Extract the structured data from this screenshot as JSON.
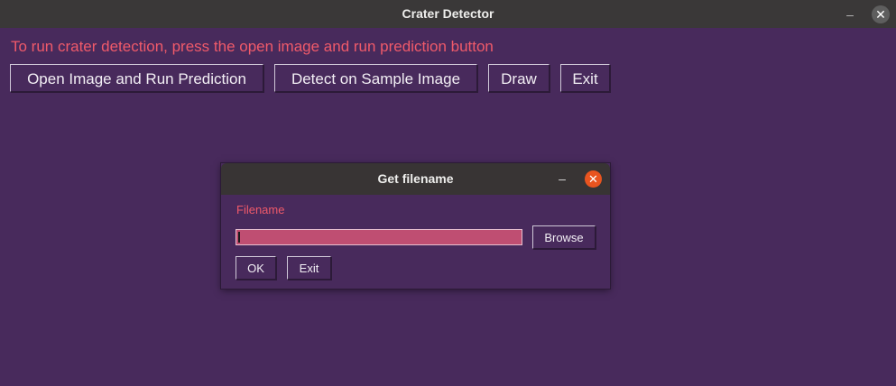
{
  "window": {
    "title": "Crater Detector",
    "minimize_glyph": "–",
    "close_glyph": "✕"
  },
  "main": {
    "instruction": "To run crater detection, press the open image and run prediction button",
    "buttons": {
      "open_predict": "Open Image and Run Prediction",
      "detect_sample": "Detect on Sample Image",
      "draw": "Draw",
      "exit": "Exit"
    }
  },
  "dialog": {
    "title": "Get filename",
    "minimize_glyph": "–",
    "close_glyph": "✕",
    "label": "Filename",
    "input_value": "",
    "browse": "Browse",
    "ok": "OK",
    "exit": "Exit"
  },
  "colors": {
    "background": "#482a5c",
    "titlebar": "#3a3838",
    "accent_text": "#f05a6a",
    "input_fill": "#bf4e72",
    "dialog_close": "#e9541f"
  }
}
